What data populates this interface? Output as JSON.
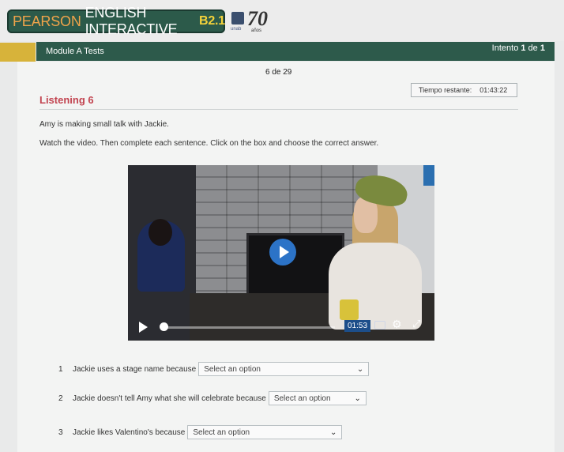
{
  "header": {
    "brand_part1": "PEARSON",
    "brand_part2": "ENGLISH INTERACTIVE",
    "brand_level": "B2.1",
    "partner_logo_text": "unab",
    "anniversary_number": "70",
    "anniversary_word": "años"
  },
  "topbar": {
    "module_label": "Module A Tests",
    "attempt_prefix": "Intento",
    "attempt_current": "1",
    "attempt_of": "de",
    "attempt_total": "1"
  },
  "question_counter": "6 de 29",
  "timer": {
    "label": "Tiempo restante:",
    "value": "01:43:22"
  },
  "section_title": "Listening 6",
  "intro_text": "Amy is making small talk with Jackie.",
  "instruction_text": "Watch the video. Then complete each sentence. Click on the box and choose the correct answer.",
  "video": {
    "time_remaining": "01:53",
    "progress_fraction": 0.0,
    "icons": [
      "play-icon",
      "captions-icon",
      "gear-icon",
      "fullscreen-icon"
    ]
  },
  "questions": [
    {
      "number": "1",
      "text": "Jackie uses a stage name because",
      "selected": "Select an option"
    },
    {
      "number": "2",
      "text": "Jackie doesn't tell Amy what she will celebrate because",
      "selected": "Select an option"
    },
    {
      "number": "3",
      "text": "Jackie likes Valentino's because",
      "selected": "Select an option"
    }
  ],
  "colors": {
    "brand_green": "#2d5a4b",
    "accent_yellow": "#d7b33a",
    "title_red": "#c24450",
    "play_blue": "#2c73c7"
  }
}
